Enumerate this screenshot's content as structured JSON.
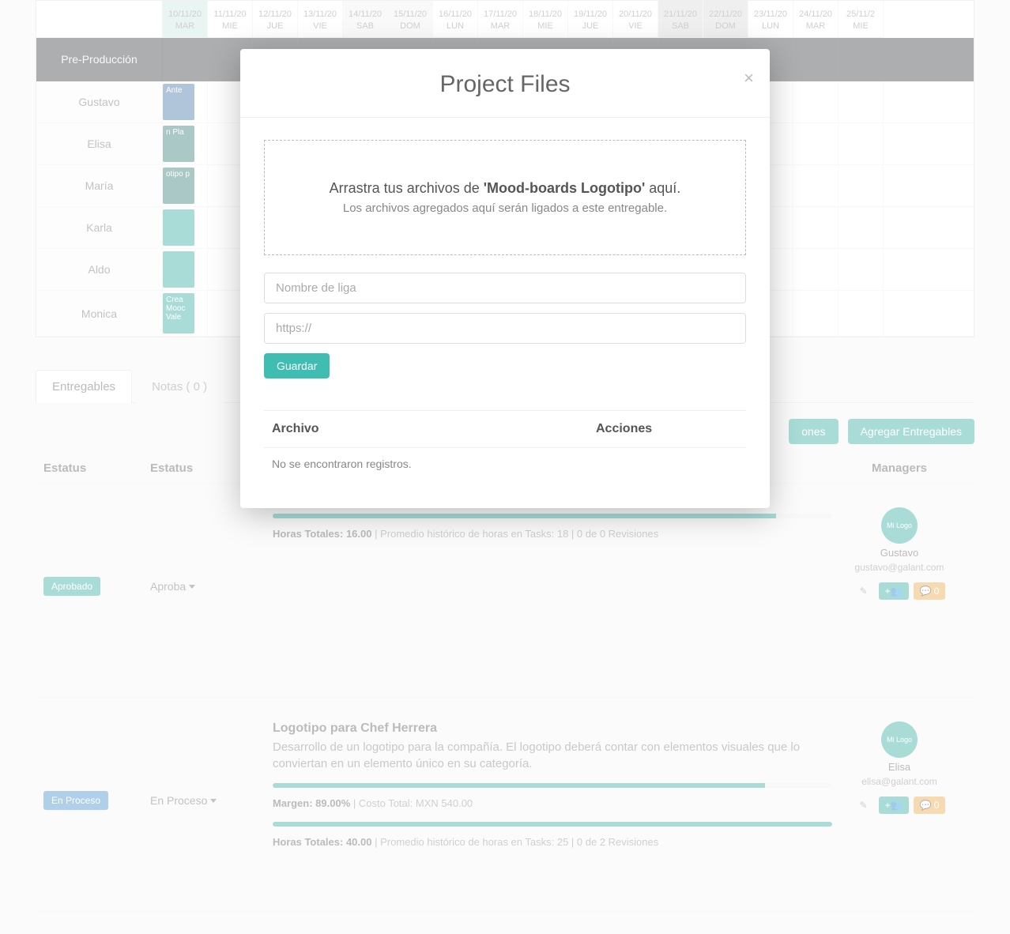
{
  "gantt": {
    "section": "Pre-Producción",
    "dates": [
      {
        "date": "10/11/20",
        "day": "MAR",
        "cls": "active"
      },
      {
        "date": "11/11/20",
        "day": "MIE",
        "cls": ""
      },
      {
        "date": "12/11/20",
        "day": "JUE",
        "cls": ""
      },
      {
        "date": "13/11/20",
        "day": "VIE",
        "cls": ""
      },
      {
        "date": "14/11/20",
        "day": "SAB",
        "cls": "weekend"
      },
      {
        "date": "15/11/20",
        "day": "DOM",
        "cls": "weekend"
      },
      {
        "date": "16/11/20",
        "day": "LUN",
        "cls": ""
      },
      {
        "date": "17/11/20",
        "day": "MAR",
        "cls": ""
      },
      {
        "date": "18/11/20",
        "day": "MIE",
        "cls": ""
      },
      {
        "date": "19/11/20",
        "day": "JUE",
        "cls": ""
      },
      {
        "date": "20/11/20",
        "day": "VIE",
        "cls": ""
      },
      {
        "date": "21/11/20",
        "day": "SAB",
        "cls": "grey"
      },
      {
        "date": "22/11/20",
        "day": "DOM",
        "cls": "grey"
      },
      {
        "date": "23/11/20",
        "day": "LUN",
        "cls": ""
      },
      {
        "date": "24/11/20",
        "day": "MAR",
        "cls": ""
      },
      {
        "date": "25/11/2",
        "day": "MIE",
        "cls": ""
      }
    ],
    "rows": [
      {
        "name": "Gustavo",
        "task": "Ante",
        "cls": "blue"
      },
      {
        "name": "Elisa",
        "task": "n Pla",
        "cls": "darkteal"
      },
      {
        "name": "María",
        "task": "otipo p",
        "cls": "darkteal"
      },
      {
        "name": "Karla",
        "task": "",
        "cls": ""
      },
      {
        "name": "Aldo",
        "task": "",
        "cls": ""
      },
      {
        "name": "Monica",
        "task": "Crea Mooc Vale",
        "cls": ""
      }
    ]
  },
  "tabs": {
    "deliverables": "Entregables",
    "notes": "Notas ( 0 )"
  },
  "actions": {
    "sections": "ones",
    "add": "Agregar Entregables"
  },
  "table": {
    "h_status": "Estatus",
    "h_status2": "Estatus",
    "h_managers": "Managers"
  },
  "delivs": [
    {
      "badge": "Aprobado",
      "badgeCls": "badge-green",
      "status": "Aproba",
      "title": "",
      "desc": "",
      "hours_label": "Horas Totales: 16.00",
      "hours_meta": " | Promedio histórico de horas en Tasks: 18 | 0 de 0 Revisiones",
      "progress": 90,
      "manager": {
        "name": "Gustavo",
        "email": "gustavo@galant.com",
        "avatar": "Mi Logo"
      },
      "comments": "0"
    },
    {
      "badge": "En Proceso",
      "badgeCls": "badge-blue",
      "status": "En Proceso",
      "title": "Logotipo para Chef Herrera",
      "desc": "Desarrollo de un logotipo para la compañía. El logotipo deberá contar con elementos visuales que lo conviertan en un elemento único en su categoría.",
      "margin_label": "Margen: 89.00%",
      "margin_meta": " | Costo Total: MXN 540.00",
      "hours_label": "Horas Totales: 40.00",
      "hours_meta": " | Promedio histórico de horas en Tasks: 25 | 0 de 2 Revisiones",
      "progress": 88,
      "manager": {
        "name": "Elisa",
        "email": "elisa@galant.com",
        "avatar": "Mi Logo"
      },
      "comments": "0"
    }
  ],
  "modal": {
    "title": "Project Files",
    "drop_pre": "Arrastra tus archivos de ",
    "drop_bold": "'Mood-boards Logotipo'",
    "drop_post": " aquí.",
    "drop_sub": "Los archivos agregados aquí serán ligados a este entregable.",
    "link_name_ph": "Nombre de liga",
    "link_url_ph": "https://",
    "save": "Guardar",
    "col_file": "Archivo",
    "col_actions": "Acciones",
    "empty": "No se encontraron registros."
  }
}
